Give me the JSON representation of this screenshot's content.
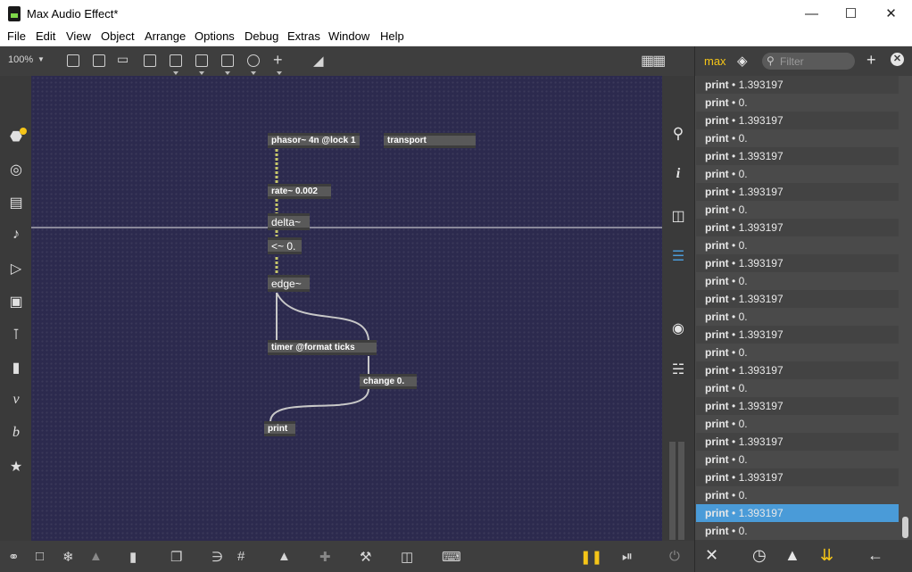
{
  "window": {
    "title": "Max Audio Effect*"
  },
  "menu": [
    "File",
    "Edit",
    "View",
    "Object",
    "Arrange",
    "Options",
    "Debug",
    "Extras",
    "Window",
    "Help"
  ],
  "toolbar": {
    "zoom": "100%"
  },
  "patch": {
    "objects": [
      "phasor~ 4n @lock 1",
      "transport",
      "rate~ 0.002",
      "delta~",
      "<~ 0.",
      "edge~",
      "timer @format ticks",
      "change 0.",
      "print"
    ]
  },
  "console": {
    "tab_label": "max",
    "filter_placeholder": "Filter",
    "rows": [
      {
        "source": "print",
        "sep": "•",
        "value": "1.393197",
        "selected": false
      },
      {
        "source": "print",
        "sep": "•",
        "value": "0.",
        "selected": false
      },
      {
        "source": "print",
        "sep": "•",
        "value": "1.393197",
        "selected": false
      },
      {
        "source": "print",
        "sep": "•",
        "value": "0.",
        "selected": false
      },
      {
        "source": "print",
        "sep": "•",
        "value": "1.393197",
        "selected": false
      },
      {
        "source": "print",
        "sep": "•",
        "value": "0.",
        "selected": false
      },
      {
        "source": "print",
        "sep": "•",
        "value": "1.393197",
        "selected": false
      },
      {
        "source": "print",
        "sep": "•",
        "value": "0.",
        "selected": false
      },
      {
        "source": "print",
        "sep": "•",
        "value": "1.393197",
        "selected": false
      },
      {
        "source": "print",
        "sep": "•",
        "value": "0.",
        "selected": false
      },
      {
        "source": "print",
        "sep": "•",
        "value": "1.393197",
        "selected": false
      },
      {
        "source": "print",
        "sep": "•",
        "value": "0.",
        "selected": false
      },
      {
        "source": "print",
        "sep": "•",
        "value": "1.393197",
        "selected": false
      },
      {
        "source": "print",
        "sep": "•",
        "value": "0.",
        "selected": false
      },
      {
        "source": "print",
        "sep": "•",
        "value": "1.393197",
        "selected": false
      },
      {
        "source": "print",
        "sep": "•",
        "value": "0.",
        "selected": false
      },
      {
        "source": "print",
        "sep": "•",
        "value": "1.393197",
        "selected": false
      },
      {
        "source": "print",
        "sep": "•",
        "value": "0.",
        "selected": false
      },
      {
        "source": "print",
        "sep": "•",
        "value": "1.393197",
        "selected": false
      },
      {
        "source": "print",
        "sep": "•",
        "value": "0.",
        "selected": false
      },
      {
        "source": "print",
        "sep": "•",
        "value": "1.393197",
        "selected": false
      },
      {
        "source": "print",
        "sep": "•",
        "value": "0.",
        "selected": false
      },
      {
        "source": "print",
        "sep": "•",
        "value": "1.393197",
        "selected": false
      },
      {
        "source": "print",
        "sep": "•",
        "value": "0.",
        "selected": false
      },
      {
        "source": "print",
        "sep": "•",
        "value": "1.393197",
        "selected": true
      },
      {
        "source": "print",
        "sep": "•",
        "value": "0.",
        "selected": false
      }
    ]
  },
  "colors": {
    "canvas_bg": "#2c2a4e",
    "object_bg": "#595959",
    "accent_yellow": "#f5c518",
    "selected_row": "#4a9bd8",
    "active_icon": "#4a9bd8",
    "patch_cord": "#c8c8c8",
    "signal_cord": "#c8c86a"
  },
  "icons": {
    "left_sidebar": [
      "packages-icon",
      "audio-icon",
      "video-icon",
      "music-icon",
      "media-icon",
      "image-icon",
      "clip-icon",
      "plugin-icon",
      "v8-icon",
      "b-icon",
      "star-icon"
    ],
    "right_sidebar": [
      "search-icon",
      "info-icon",
      "book-icon",
      "list-icon",
      "camera-icon",
      "sliders-icon"
    ]
  }
}
